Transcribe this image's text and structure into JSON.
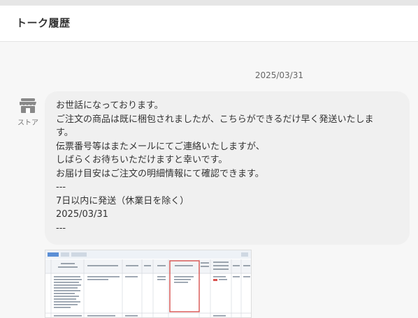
{
  "header": {
    "title": "トーク履歴"
  },
  "message": {
    "date": "2025/03/31",
    "sender_label": "ストア",
    "sender_icon": "store-icon",
    "lines": [
      "お世話になっております。",
      "ご注文の商品は既に梱包されましたが、こちらができるだけ早く発送いたしま",
      "す。",
      "伝票番号等はまたメールにてご連絡いたしますが、",
      "しばらくお待ちいただけますと幸いです。",
      "お届け目安はご注文の明細情報にて確認できます。",
      "---",
      "7日以内に発送（休業日を除く）",
      "2025/03/31",
      "---"
    ]
  },
  "attachment": {
    "type": "screenshot-image",
    "highlight_color": "#d9534f"
  }
}
